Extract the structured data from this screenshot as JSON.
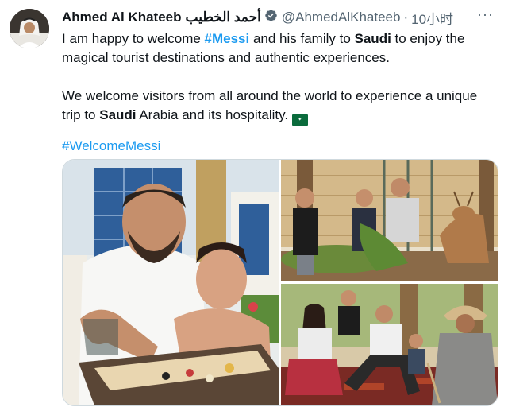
{
  "tweet": {
    "author_name": "Ahmed Al Khateeb",
    "author_name_arabic": "أحمد الخطيب",
    "handle": "@AhmedAlKhateeb",
    "separator": "·",
    "time": "10小时",
    "more_label": "···",
    "para1": {
      "t1": "I am happy to welcome ",
      "hashtag": "#Messi",
      "t2": " and his family to ",
      "saudi": "Saudi",
      "t3": " to enjoy the magical tourist destinations and authentic experiences."
    },
    "para2": {
      "t1": "We welcome visitors from all around the world to experience a unique trip to ",
      "saudi": "Saudi",
      "t2": " Arabia and its hospitality. "
    },
    "hashtag": "#WelcomeMessi"
  },
  "icons": {
    "verified": "verified-badge-icon",
    "flag": "saudi-flag-emoji",
    "more": "more-options-icon"
  },
  "colors": {
    "link": "#1d9bf0",
    "secondary_text": "#536471",
    "primary_text": "#0f1419",
    "flag_green": "#0a6b3c"
  }
}
